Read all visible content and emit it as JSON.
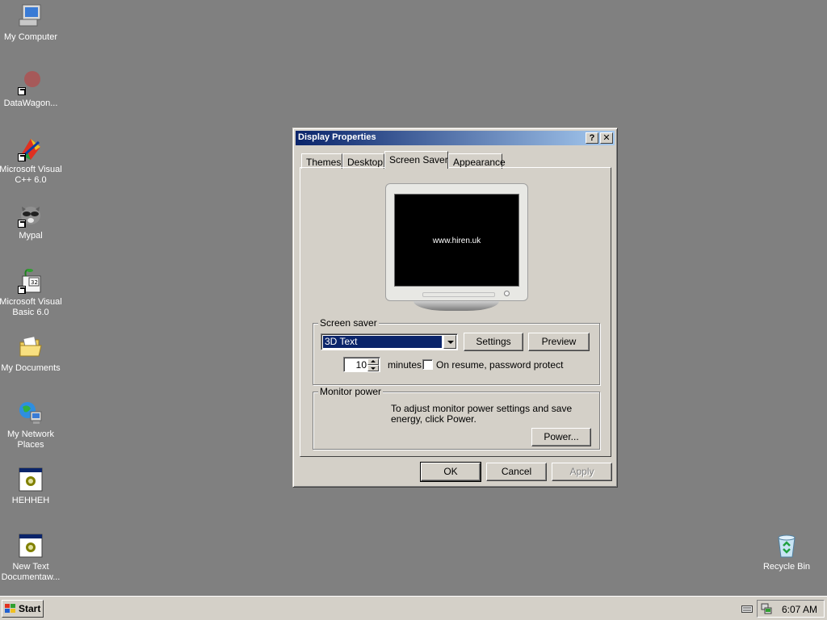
{
  "desktop": {
    "icons": [
      {
        "name": "my-computer",
        "label": "My Computer"
      },
      {
        "name": "datawagon",
        "label": "DataWagon..."
      },
      {
        "name": "msvc",
        "label": "Microsoft Visual\nC++ 6.0"
      },
      {
        "name": "mypal",
        "label": "Mypal"
      },
      {
        "name": "msvb",
        "label": "Microsoft Visual\nBasic 6.0"
      },
      {
        "name": "my-documents",
        "label": "My Documents"
      },
      {
        "name": "my-network-places",
        "label": "My Network\nPlaces"
      },
      {
        "name": "hehheh",
        "label": "HEHHEH"
      },
      {
        "name": "new-text-document",
        "label": "New Text\nDocumentaw..."
      },
      {
        "name": "recycle-bin",
        "label": "Recycle Bin"
      }
    ]
  },
  "window": {
    "title": "Display Properties",
    "help_button": "?",
    "close_button": "✕",
    "tabs": [
      {
        "label": "Themes"
      },
      {
        "label": "Desktop"
      },
      {
        "label": "Screen Saver",
        "active": true
      },
      {
        "label": "Appearance"
      }
    ],
    "preview_text": "www.hiren.uk",
    "screen_saver": {
      "group_label": "Screen saver",
      "selected": "3D Text",
      "settings_button": "Settings",
      "preview_button": "Preview",
      "wait_value": "10",
      "minutes_label": "minutes",
      "password_label": "On resume, password protect",
      "password_checked": false
    },
    "monitor_power": {
      "group_label": "Monitor power",
      "description": "To adjust monitor power settings and save energy, click Power.",
      "power_button": "Power..."
    },
    "buttons": {
      "ok": "OK",
      "cancel": "Cancel",
      "apply": "Apply"
    }
  },
  "taskbar": {
    "start_label": "Start",
    "clock": "6:07 AM"
  }
}
